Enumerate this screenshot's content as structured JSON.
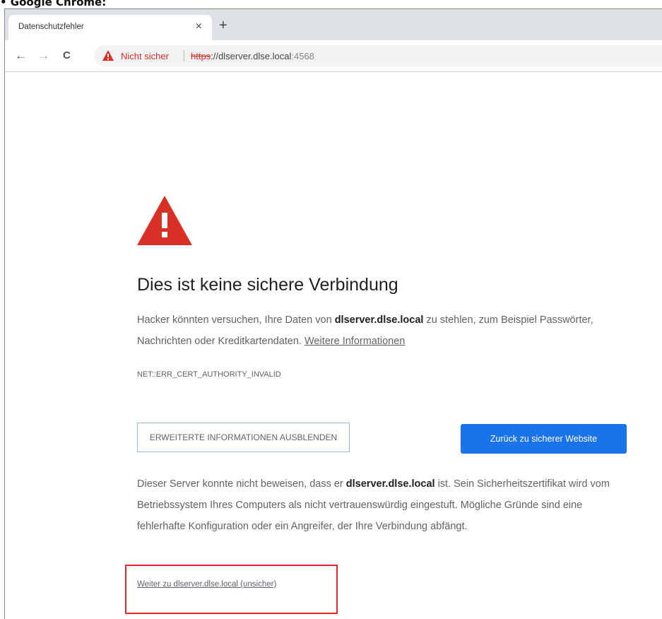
{
  "caption": "• Google Chrome:",
  "browser": {
    "tab_title": "Datenschutzfehler",
    "tab_close": "×",
    "new_tab": "+",
    "back": "←",
    "forward": "→",
    "reload": "C",
    "security_label": "Nicht sicher",
    "url_scheme": "https",
    "url_sep": "://",
    "url_host": "dlserver.dlse.local",
    "url_port": ":4568"
  },
  "page": {
    "heading": "Dies ist keine sichere Verbindung",
    "intro_before": "Hacker könnten versuchen, Ihre Daten von ",
    "intro_host": "dlserver.dlse.local",
    "intro_after": " zu stehlen, zum Beispiel Passwörter, Nachrichten oder Kreditkartendaten. ",
    "more_info_link": "Weitere Informationen",
    "error_code": "NET::ERR_CERT_AUTHORITY_INVALID",
    "details_button": "ERWEITERTE INFORMATIONEN AUSBLENDEN",
    "back_button": "Zurück zu sicherer Website",
    "details_before": "Dieser Server konnte nicht beweisen, dass er ",
    "details_host": "dlserver.dlse.local",
    "details_after": " ist. Sein Sicherheitszertifikat wird vom Betriebssystem Ihres Computers als nicht vertrauenswürdig eingestuft. Mögliche Gründe sind eine fehlerhafte Konfiguration oder ein Angreifer, der Ihre Verbindung abfängt.",
    "proceed_link": "Weiter zu dlserver.dlse.local (unsicher)"
  },
  "colors": {
    "warning_red": "#d93025",
    "primary_blue": "#1a73e8",
    "highlight_red": "#e5262f"
  },
  "icons": [
    "warning-triangle-icon",
    "back-arrow-icon",
    "forward-arrow-icon",
    "reload-icon",
    "close-icon",
    "plus-icon"
  ]
}
